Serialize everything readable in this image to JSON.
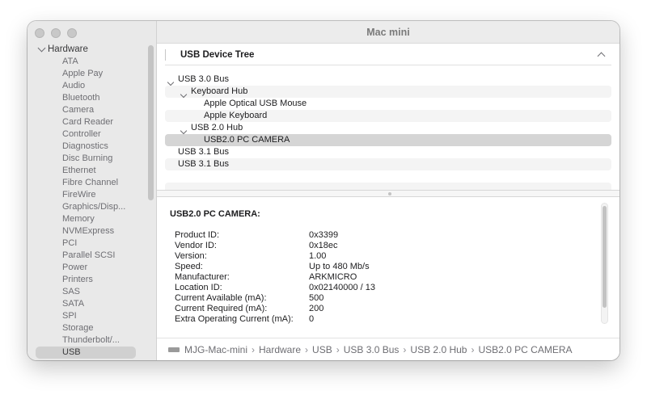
{
  "window": {
    "title": "Mac mini"
  },
  "sidebar": {
    "section": "Hardware",
    "items": [
      {
        "label": "ATA"
      },
      {
        "label": "Apple Pay"
      },
      {
        "label": "Audio"
      },
      {
        "label": "Bluetooth"
      },
      {
        "label": "Camera"
      },
      {
        "label": "Card Reader"
      },
      {
        "label": "Controller"
      },
      {
        "label": "Diagnostics"
      },
      {
        "label": "Disc Burning"
      },
      {
        "label": "Ethernet"
      },
      {
        "label": "Fibre Channel"
      },
      {
        "label": "FireWire"
      },
      {
        "label": "Graphics/Disp..."
      },
      {
        "label": "Memory"
      },
      {
        "label": "NVMExpress"
      },
      {
        "label": "PCI"
      },
      {
        "label": "Parallel SCSI"
      },
      {
        "label": "Power"
      },
      {
        "label": "Printers"
      },
      {
        "label": "SAS"
      },
      {
        "label": "SATA"
      },
      {
        "label": "SPI"
      },
      {
        "label": "Storage"
      },
      {
        "label": "Thunderbolt/..."
      },
      {
        "label": "USB",
        "selected": true
      }
    ]
  },
  "tree": {
    "title": "USB Device Tree",
    "rows": [
      {
        "label": "USB 3.0 Bus",
        "level": 0,
        "expanded": true
      },
      {
        "label": "Keyboard Hub",
        "level": 1,
        "expanded": true
      },
      {
        "label": "Apple Optical USB Mouse",
        "level": 2
      },
      {
        "label": "Apple Keyboard",
        "level": 2
      },
      {
        "label": "USB 2.0 Hub",
        "level": 1,
        "expanded": true
      },
      {
        "label": "USB2.0 PC CAMERA",
        "level": 2,
        "selected": true
      },
      {
        "label": "USB 3.1 Bus",
        "level": 0
      },
      {
        "label": "USB 3.1 Bus",
        "level": 0
      },
      {
        "label": "",
        "level": 0
      },
      {
        "label": "",
        "level": 0
      }
    ]
  },
  "details": {
    "title": "USB2.0 PC CAMERA:",
    "properties": [
      {
        "key": "Product ID:",
        "value": "0x3399"
      },
      {
        "key": "Vendor ID:",
        "value": "0x18ec"
      },
      {
        "key": "Version:",
        "value": "1.00"
      },
      {
        "key": "Speed:",
        "value": "Up to 480 Mb/s"
      },
      {
        "key": "Manufacturer:",
        "value": "ARKMICRO"
      },
      {
        "key": "Location ID:",
        "value": "0x02140000 / 13"
      },
      {
        "key": "Current Available (mA):",
        "value": "500"
      },
      {
        "key": "Current Required (mA):",
        "value": "200"
      },
      {
        "key": "Extra Operating Current (mA):",
        "value": "0"
      }
    ]
  },
  "pathbar": {
    "icon": "mac-mini-icon",
    "crumbs": [
      "MJG-Mac-mini",
      "Hardware",
      "USB",
      "USB 3.0 Bus",
      "USB 2.0 Hub",
      "USB2.0 PC CAMERA"
    ]
  },
  "colors": {
    "selection": "#d0d0d0",
    "sidebar_bg": "#e9e9e9"
  }
}
